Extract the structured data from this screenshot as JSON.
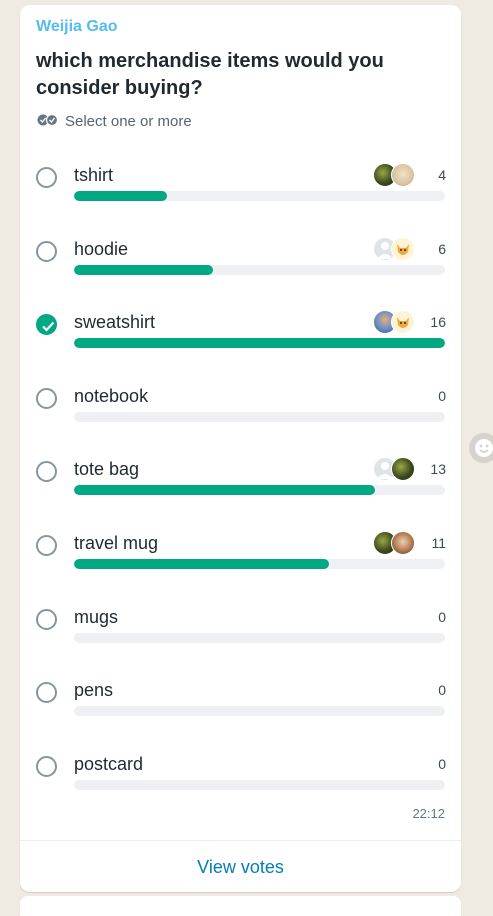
{
  "poll": {
    "sender": "Weijia Gao",
    "question": "which merchandise items would you consider buying?",
    "hint": "Select one or more",
    "max_votes": 16,
    "accent_color": "#00a884",
    "options": [
      {
        "label": "tshirt",
        "count": "4",
        "votes": 4,
        "checked": false,
        "avatars": [
          "photo-green",
          "photo-cream"
        ]
      },
      {
        "label": "hoodie",
        "count": "6",
        "votes": 6,
        "checked": false,
        "avatars": [
          "default-person",
          "cartoon-cat"
        ]
      },
      {
        "label": "sweatshirt",
        "count": "16",
        "votes": 16,
        "checked": true,
        "avatars": [
          "photo-blue",
          "cartoon-cat"
        ]
      },
      {
        "label": "notebook",
        "count": "0",
        "votes": 0,
        "checked": false,
        "avatars": []
      },
      {
        "label": "tote bag",
        "count": "13",
        "votes": 13,
        "checked": false,
        "avatars": [
          "default-person",
          "photo-green"
        ]
      },
      {
        "label": "travel mug",
        "count": "11",
        "votes": 11,
        "checked": false,
        "avatars": [
          "photo-green",
          "photo-face"
        ]
      },
      {
        "label": "mugs",
        "count": "0",
        "votes": 0,
        "checked": false,
        "avatars": []
      },
      {
        "label": "pens",
        "count": "0",
        "votes": 0,
        "checked": false,
        "avatars": []
      },
      {
        "label": "postcard",
        "count": "0",
        "votes": 0,
        "checked": false,
        "avatars": []
      }
    ],
    "time": "22:12",
    "view_votes_label": "View votes"
  }
}
